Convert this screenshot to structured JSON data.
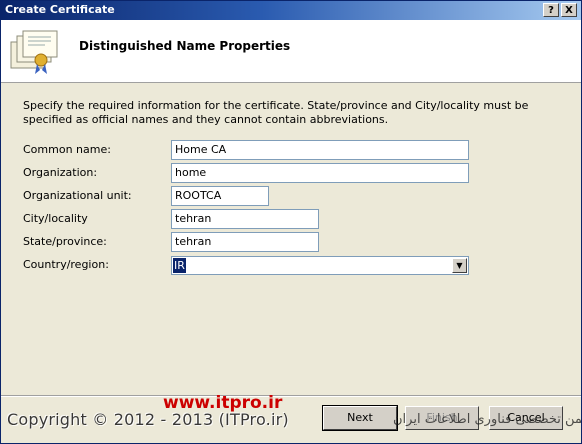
{
  "window": {
    "title": "Create Certificate",
    "help_glyph": "?",
    "close_glyph": "X"
  },
  "header": {
    "title": "Distinguished Name Properties",
    "icon": "certificate-icon"
  },
  "instructions": "Specify the required information for the certificate. State/province and City/locality must be specified as official names and they cannot contain abbreviations.",
  "form": {
    "common_name": {
      "label": "Common name:",
      "value": "Home CA"
    },
    "organization": {
      "label": "Organization:",
      "value": "home"
    },
    "organizational_unit": {
      "label": "Organizational unit:",
      "value": "ROOTCA"
    },
    "city": {
      "label": "City/locality",
      "value": "tehran"
    },
    "state": {
      "label": "State/province:",
      "value": "tehran"
    },
    "country": {
      "label": "Country/region:",
      "value": "IR"
    }
  },
  "buttons": {
    "next": "Next",
    "finish": "Finish",
    "cancel": "Cancel"
  },
  "watermark": {
    "url": "www.itpro.ir",
    "copyright": "Copyright © 2012 - 2013 (ITPro.ir)",
    "rtl_text": "انجمن تخصصی فناوری اطلاعات ایران"
  },
  "colors": {
    "title_bar": "#0a246a",
    "watermark_url": "#cc0000",
    "selection": "#0a246a"
  }
}
